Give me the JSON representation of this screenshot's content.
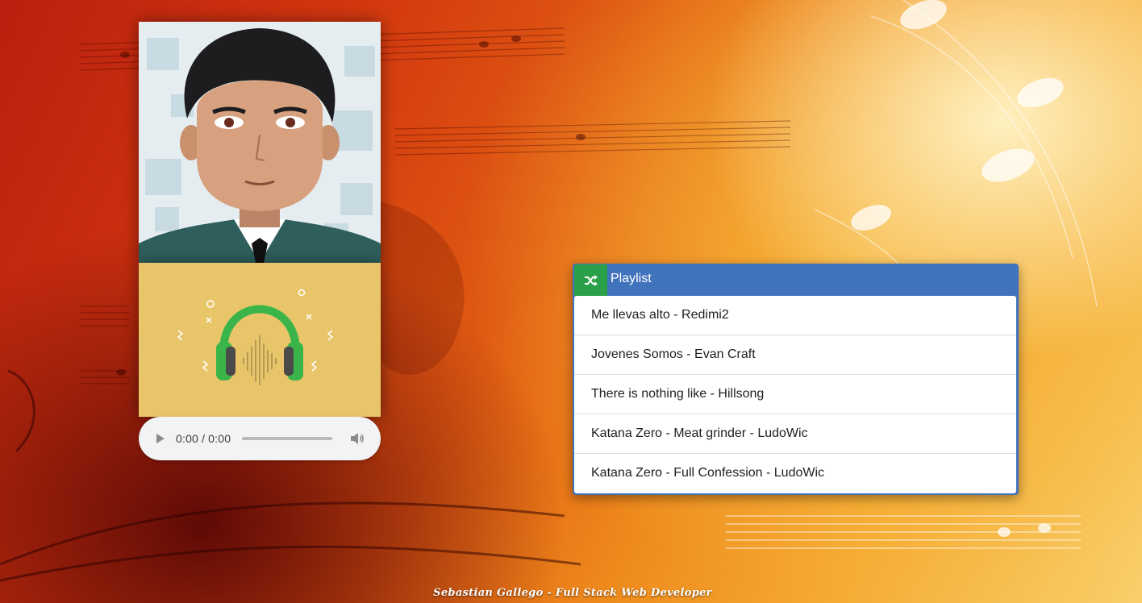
{
  "player": {
    "current_time": "0:00",
    "duration": "0:00",
    "progress": 0
  },
  "playlist": {
    "title": "Playlist",
    "shuffle_icon": "shuffle-icon",
    "tracks": [
      "Me llevas alto - Redimi2",
      "Jovenes Somos - Evan Craft",
      "There is nothing like - Hillsong",
      "Katana Zero - Meat grinder - LudoWic",
      "Katana Zero - Full Confession - LudoWic"
    ]
  },
  "footer": {
    "credit": "Sebastian Gallego - Full Stack Web Developer"
  },
  "colors": {
    "playlist_header": "#4173bd",
    "shuffle_button": "#2aa04a",
    "album_background": "#e9c56a",
    "headphones": "#3bb54a"
  }
}
